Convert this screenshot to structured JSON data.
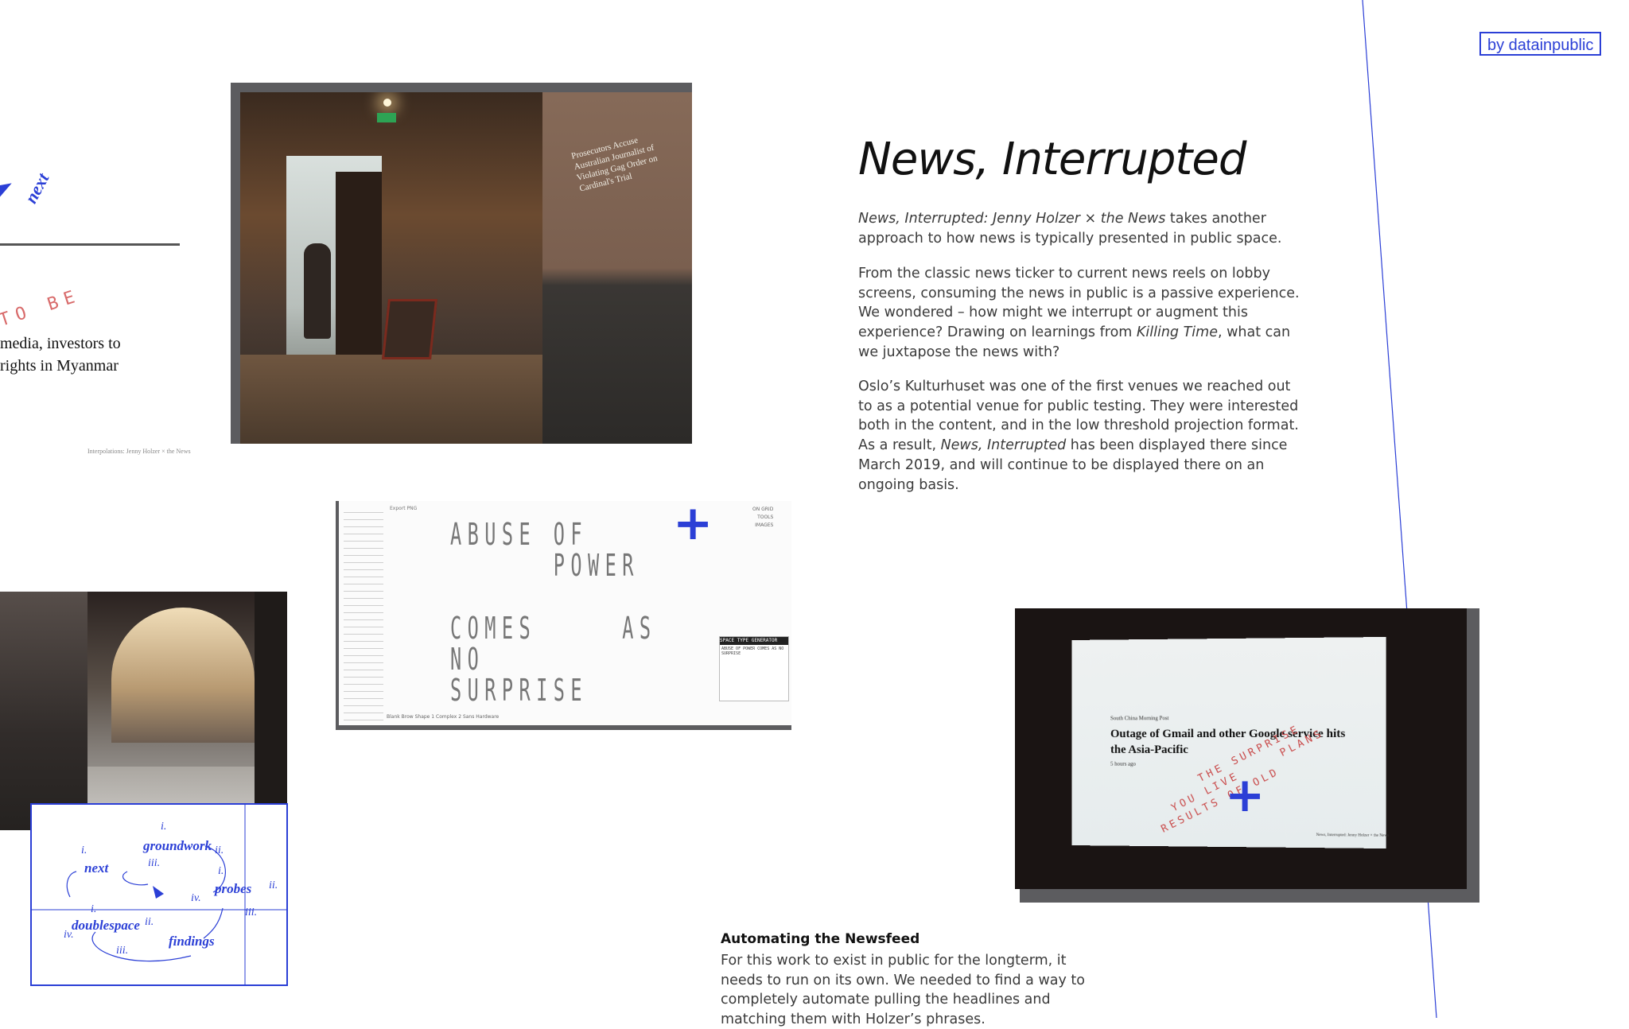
{
  "badge": "by datainpublic",
  "left_preview": {
    "next_label": "next",
    "red_text": "TO BE",
    "headline_line1": "media, investors to",
    "headline_line2": "rights in Myanmar",
    "caption": "Interpolations: Jenny Holzer × the News"
  },
  "photo1": {
    "projected_text": "Prosecutors Accuse Australian Journalist of Violating Gag Order on Cardinal's Trial"
  },
  "article": {
    "title": "News, Interrupted",
    "p1_italic": "News, Interrupted: Jenny Holzer × the News",
    "p1_rest": " takes another approach to how news is typically presented in public space.",
    "p2_a": "From the classic news ticker to current news reels on lobby screens, consuming the news in public is a passive experience. We wondered – how might we interrupt or augment this experience? Drawing on learnings from ",
    "p2_italic": "Killing Time",
    "p2_b": ", what can we juxtapose the news with?",
    "p3_a": "Oslo’s Kulturhuset was one of the first venues we reached out to as a potential venue for public testing. They were interested both in the content, and in the low threshold projection format. As a result, ",
    "p3_italic": "News, Interrupted",
    "p3_b": " has been displayed there since March 2019, and will continue to be displayed there on an ongoing basis."
  },
  "tool": {
    "line1": "ABUSE OF",
    "line2": "      POWER",
    "line3": "COMES     AS",
    "line4": "NO",
    "line5": "SURPRISE",
    "panel_title": "SPACE TYPE GENERATOR",
    "panel_text": "ABUSE OF   POWER   COMES AS NO   SURPRISE",
    "buttons": "Blank   Brow   Shape 1   Complex 2   Sans   Hardware",
    "links": "ON GRID\nTOOLS\nIMAGES",
    "mini": "Export PNG"
  },
  "plus_symbol": "+",
  "diagram": {
    "groundwork": "groundwork",
    "next": "next",
    "probes": "probes",
    "doublespace": "doublespace",
    "findings": "findings",
    "n_i": "i.",
    "n_ii": "ii.",
    "n_iii": "iii.",
    "n_iv": "iv."
  },
  "photo3": {
    "source": "South China Morning Post",
    "headline": "Outage of Gmail and other Google service hits the Asia-Pacific",
    "time": "5 hours ago",
    "red_text": "      THE SURPRISE\n  YOU LIVE     PLANS\nRESULTS OF OLD",
    "credit": "News, Interrupted: Jenny Holzer × the News"
  },
  "bottom": {
    "heading": "Automating the Newsfeed",
    "para": "For this work to exist in public for the longterm, it needs to run on its own. We needed to find a way to completely automate pulling the headlines and matching them with Holzer’s phrases."
  },
  "colors": {
    "accent": "#2b3fd6",
    "red": "#d86a6a"
  }
}
